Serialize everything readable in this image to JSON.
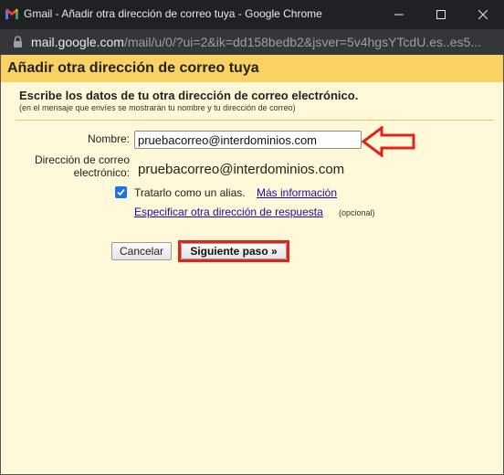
{
  "window": {
    "title": "Gmail - Añadir otra dirección de correo tuya - Google Chrome",
    "url_host": "mail.google.com",
    "url_path": "/mail/u/0/?ui=2&ik=dd158bedb2&jsver=5v4hgsYTcdU.es..es5..."
  },
  "dialog": {
    "title": "Añadir otra dirección de correo tuya",
    "heading": "Escribe los datos de tu otra dirección de correo electrónico.",
    "subheading": "(en el mensaje que envíes se mostrarán tu nombre y tu dirección de correo)",
    "name_label": "Nombre:",
    "name_value": "pruebacorreo@interdominios.com",
    "address_label": "Dirección de correo electrónico:",
    "address_value": "pruebacorreo@interdominios.com",
    "alias_checked": true,
    "alias_label": "Tratarlo como un alias.",
    "more_info_link": "Más información",
    "reply_link": "Especificar otra dirección de respuesta",
    "optional_label": "(opcional)",
    "cancel_button": "Cancelar",
    "next_button": "Siguiente paso »"
  },
  "colors": {
    "header_bg": "#fad163",
    "content_bg": "#fff8d9",
    "highlight": "#e2231a",
    "link": "#1a0dab",
    "checkbox": "#1a73e8"
  }
}
